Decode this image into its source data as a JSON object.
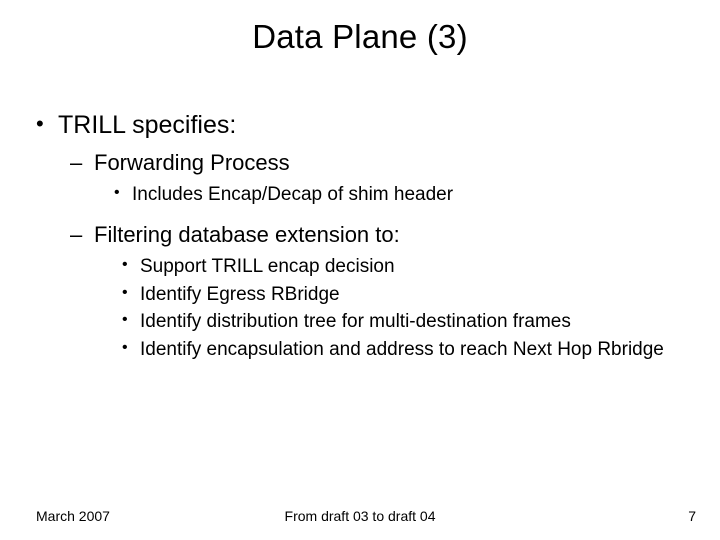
{
  "title": "Data Plane (3)",
  "bullets": {
    "b1": "TRILL specifies:",
    "b1_1": "Forwarding Process",
    "b1_1_1": "Includes Encap/Decap of shim header",
    "b1_2": "Filtering database extension to:",
    "b1_2_1": "Support TRILL encap decision",
    "b1_2_2": "Identify Egress RBridge",
    "b1_2_3": "Identify distribution tree for multi-destination frames",
    "b1_2_4": "Identify encapsulation and address to reach Next Hop Rbridge"
  },
  "footer": {
    "date": "March 2007",
    "center": "From draft 03 to draft 04",
    "page": "7"
  }
}
